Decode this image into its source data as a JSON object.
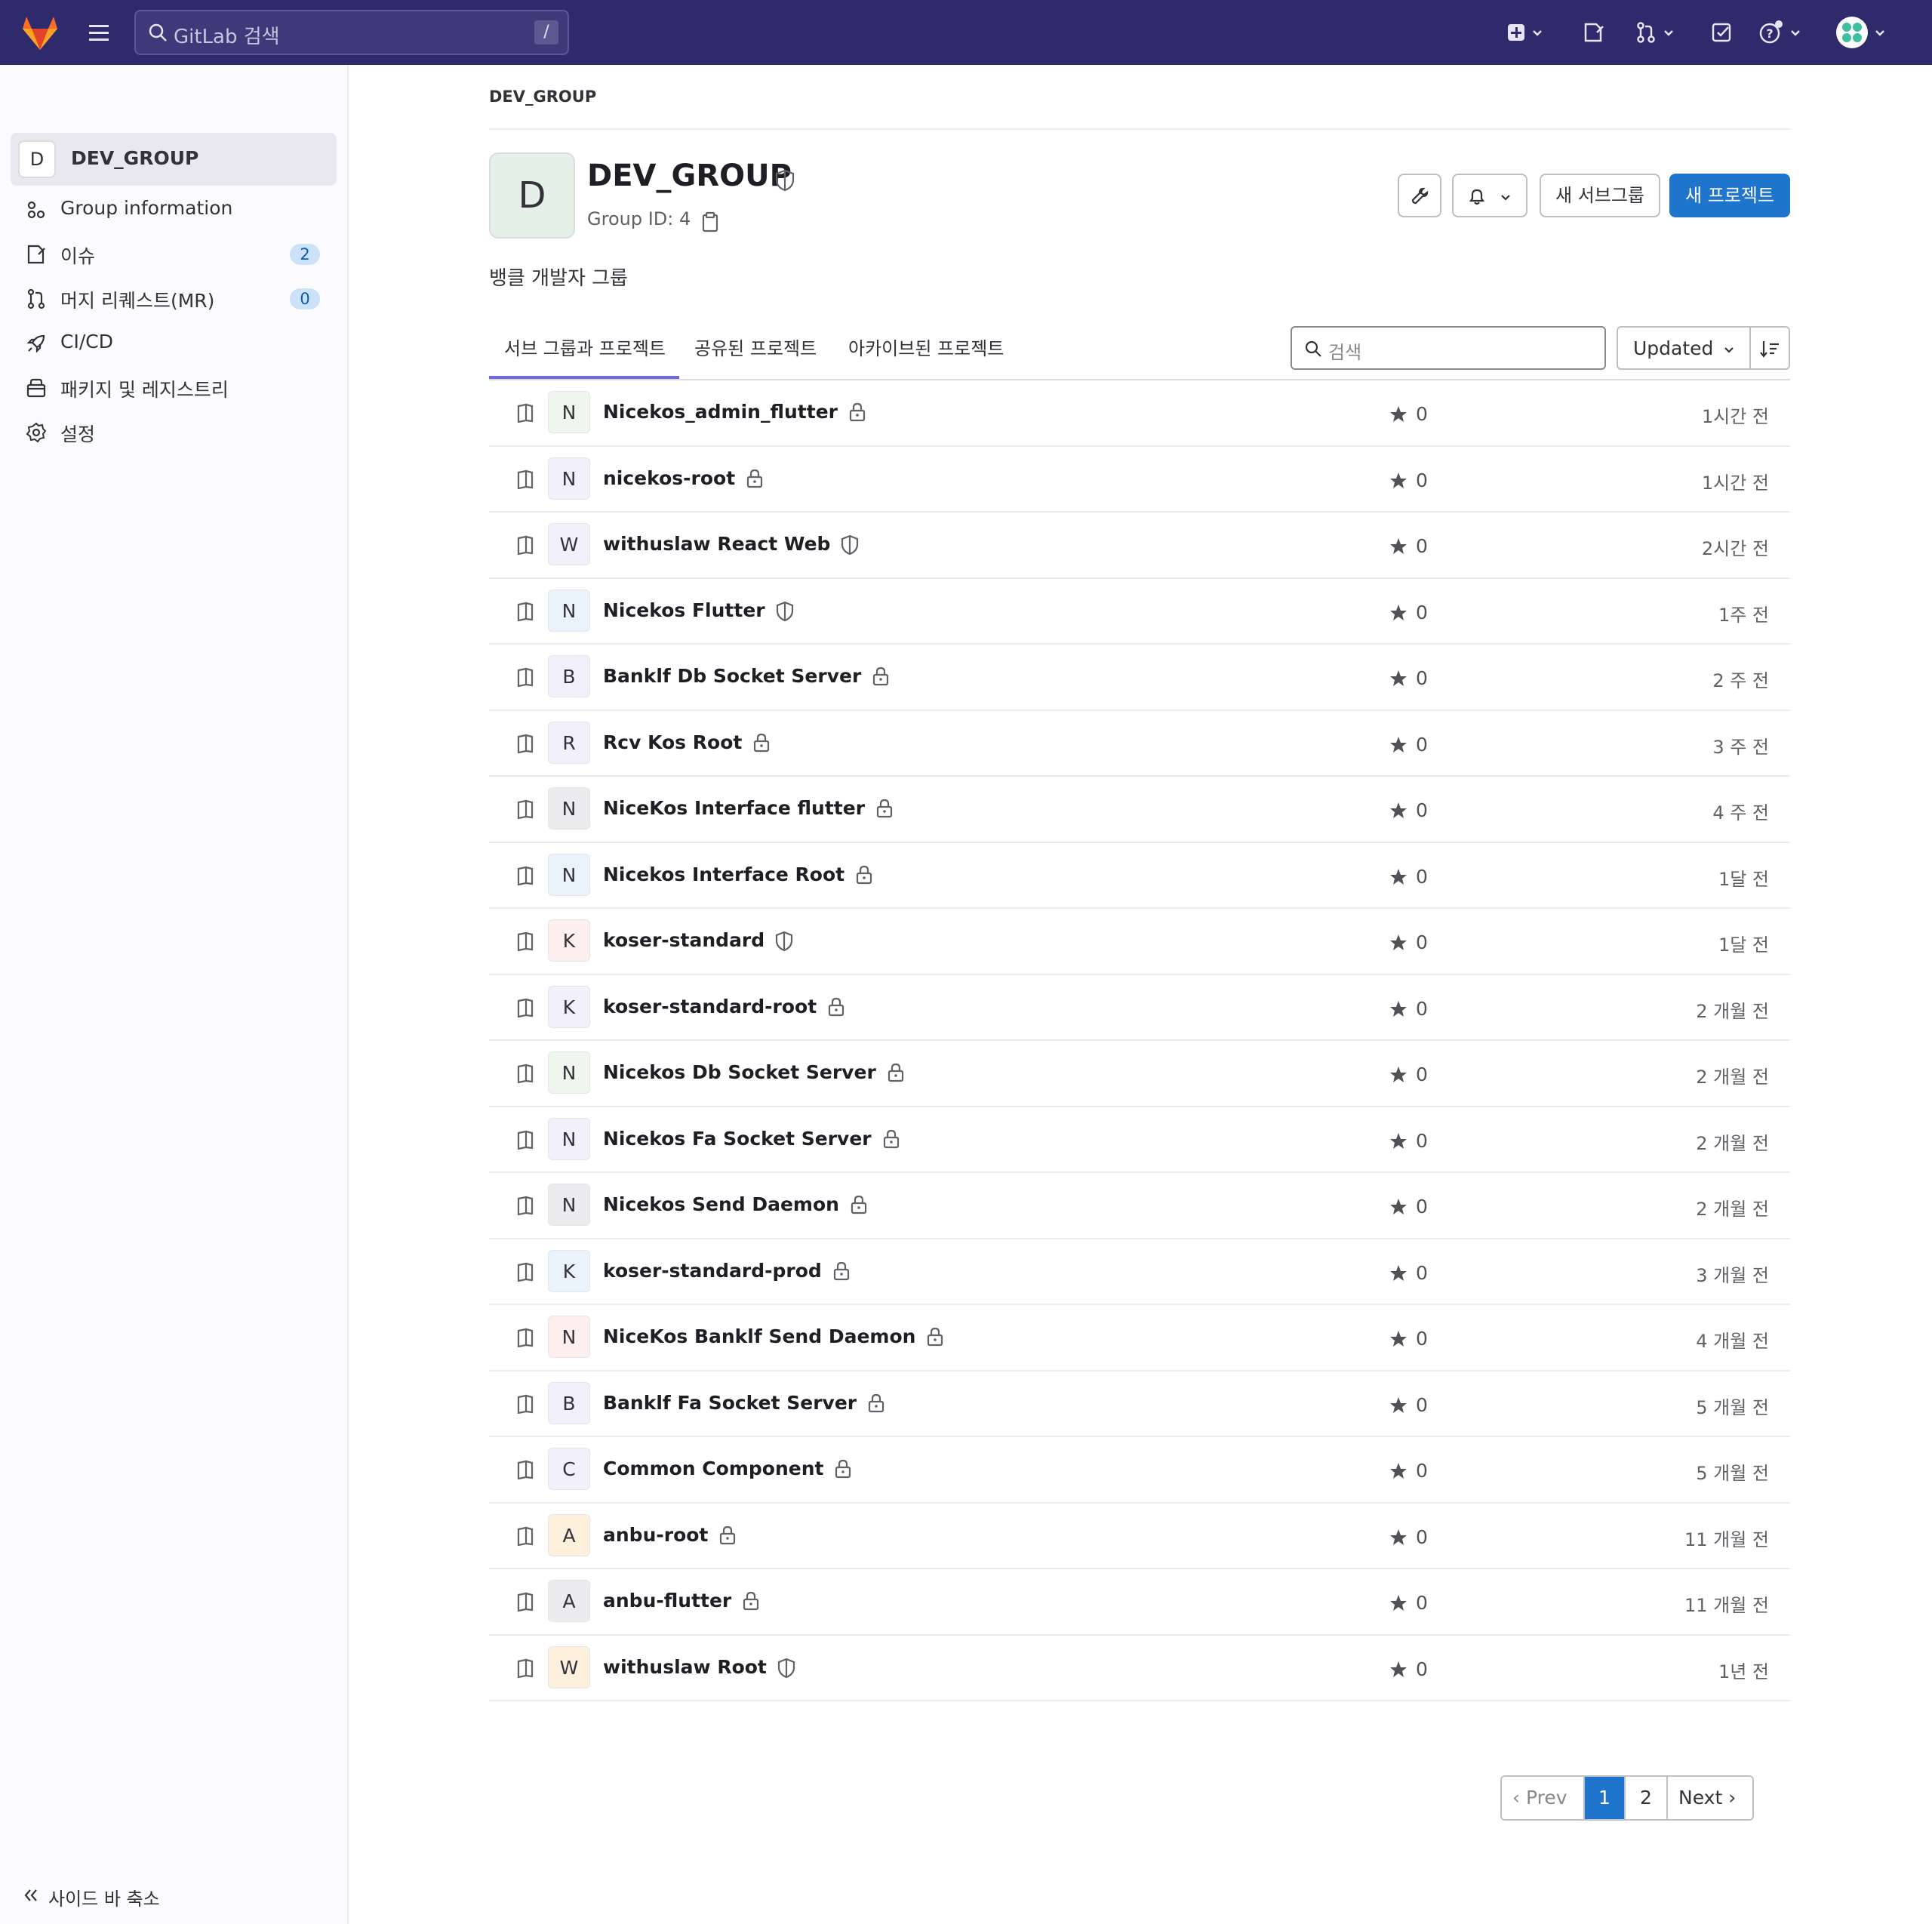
{
  "topbar": {
    "search_placeholder": "GitLab 검색",
    "search_shortcut": "/"
  },
  "sidebar": {
    "group_avatar": "D",
    "group_name": "DEV_GROUP",
    "items": [
      {
        "label": "Group information",
        "icon": "group-info-icon"
      },
      {
        "label": "이슈",
        "icon": "issues-icon",
        "badge": "2"
      },
      {
        "label": "머지 리퀘스트(MR)",
        "icon": "merge-request-icon",
        "badge": "0"
      },
      {
        "label": "CI/CD",
        "icon": "rocket-icon"
      },
      {
        "label": "패키지 및 레지스트리",
        "icon": "package-icon"
      },
      {
        "label": "설정",
        "icon": "settings-icon"
      }
    ],
    "collapse_label": "사이드 바 축소"
  },
  "breadcrumb": "DEV_GROUP",
  "group": {
    "avatar": "D",
    "title": "DEV_GROUP",
    "id_text": "Group ID: 4",
    "description": "뱅클 개발자 그룹"
  },
  "actions": {
    "new_subgroup": "새 서브그룹",
    "new_project": "새 프로젝트"
  },
  "tabs": [
    "서브 그룹과 프로젝트",
    "공유된 프로젝트",
    "아카이브된 프로젝트"
  ],
  "filter": {
    "placeholder": "검색",
    "sort_label": "Updated"
  },
  "projects": [
    {
      "avatar": "N",
      "name": "Nicekos_admin_flutter",
      "visibility": "private",
      "stars": "0",
      "updated": "1시간 전",
      "color": "#eef6ee"
    },
    {
      "avatar": "N",
      "name": "nicekos-root",
      "visibility": "private",
      "stars": "0",
      "updated": "1시간 전",
      "color": "#f1f0fb"
    },
    {
      "avatar": "W",
      "name": "withuslaw React Web",
      "visibility": "internal",
      "stars": "0",
      "updated": "2시간 전",
      "color": "#f1f0fb"
    },
    {
      "avatar": "N",
      "name": "Nicekos Flutter",
      "visibility": "internal",
      "stars": "0",
      "updated": "1주 전",
      "color": "#eaf3fb"
    },
    {
      "avatar": "B",
      "name": "Banklf Db Socket Server",
      "visibility": "private",
      "stars": "0",
      "updated": "2 주 전",
      "color": "#f1f0fb"
    },
    {
      "avatar": "R",
      "name": "Rcv Kos Root",
      "visibility": "private",
      "stars": "0",
      "updated": "3 주 전",
      "color": "#f1f0fb"
    },
    {
      "avatar": "N",
      "name": "NiceKos Interface flutter",
      "visibility": "private",
      "stars": "0",
      "updated": "4 주 전",
      "color": "#ececef"
    },
    {
      "avatar": "N",
      "name": "Nicekos Interface Root",
      "visibility": "private",
      "stars": "0",
      "updated": "1달 전",
      "color": "#eaf3fb"
    },
    {
      "avatar": "K",
      "name": "koser-standard",
      "visibility": "internal",
      "stars": "0",
      "updated": "1달 전",
      "color": "#fcefee"
    },
    {
      "avatar": "K",
      "name": "koser-standard-root",
      "visibility": "private",
      "stars": "0",
      "updated": "2 개월 전",
      "color": "#f1f0fb"
    },
    {
      "avatar": "N",
      "name": "Nicekos Db Socket Server",
      "visibility": "private",
      "stars": "0",
      "updated": "2 개월 전",
      "color": "#eef6ee"
    },
    {
      "avatar": "N",
      "name": "Nicekos Fa Socket Server",
      "visibility": "private",
      "stars": "0",
      "updated": "2 개월 전",
      "color": "#f1f0fb"
    },
    {
      "avatar": "N",
      "name": "Nicekos Send Daemon",
      "visibility": "private",
      "stars": "0",
      "updated": "2 개월 전",
      "color": "#ececef"
    },
    {
      "avatar": "K",
      "name": "koser-standard-prod",
      "visibility": "private",
      "stars": "0",
      "updated": "3 개월 전",
      "color": "#eaf3fb"
    },
    {
      "avatar": "N",
      "name": "NiceKos Banklf Send Daemon",
      "visibility": "private",
      "stars": "0",
      "updated": "4 개월 전",
      "color": "#fcefee"
    },
    {
      "avatar": "B",
      "name": "Banklf Fa Socket Server",
      "visibility": "private",
      "stars": "0",
      "updated": "5 개월 전",
      "color": "#f1f0fb"
    },
    {
      "avatar": "C",
      "name": "Common Component",
      "visibility": "private",
      "stars": "0",
      "updated": "5 개월 전",
      "color": "#f1f0fb"
    },
    {
      "avatar": "A",
      "name": "anbu-root",
      "visibility": "private",
      "stars": "0",
      "updated": "11 개월 전",
      "color": "#fdf1dd"
    },
    {
      "avatar": "A",
      "name": "anbu-flutter",
      "visibility": "private",
      "stars": "0",
      "updated": "11 개월 전",
      "color": "#ececef"
    },
    {
      "avatar": "W",
      "name": "withuslaw Root",
      "visibility": "internal",
      "stars": "0",
      "updated": "1년 전",
      "color": "#fdf1dd"
    }
  ],
  "pagination": {
    "prev": "Prev",
    "pages": [
      "1",
      "2"
    ],
    "current": "1",
    "next": "Next"
  },
  "colors": {
    "topbar": "#2f2a6b",
    "primary": "#1f75cb",
    "tab_active": "#6e6ad8"
  }
}
